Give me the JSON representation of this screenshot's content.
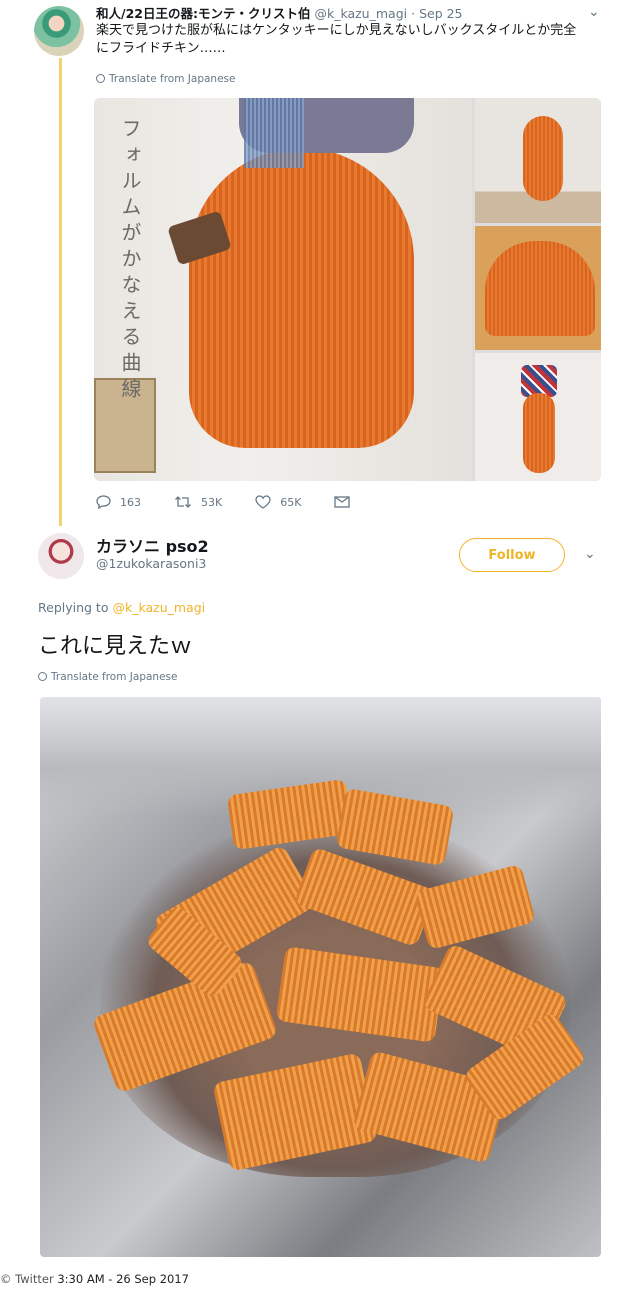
{
  "tweet1": {
    "display_name": "和人/22日王の器:モンテ・クリスト伯",
    "handle": "@k_kazu_magi",
    "separator": "·",
    "date": "Sep 25",
    "text": "楽天で見つけた服が私にはケンタッキーにしか見えないしバックスタイルとか完全にフライドチキン……",
    "translate": "Translate from Japanese",
    "image_caption": "フォルムがかなえる曲線",
    "stats": {
      "replies": "163",
      "retweets": "53K",
      "likes": "65K"
    }
  },
  "tweet2": {
    "display_name": "カラソニ pso2",
    "handle": "@1zukokarasoni3",
    "follow_label": "Follow",
    "replying_prefix": "Replying to",
    "replying_to": "@k_kazu_magi",
    "text": "これに見えたｗ",
    "translate": "Translate from Japanese"
  },
  "footer": {
    "watermark": "© Twitter",
    "timestamp": "3:30 AM - 26 Sep 2017"
  },
  "icons": {
    "reply": "speech-bubble-icon",
    "retweet": "retweet-icon",
    "like": "heart-icon",
    "message": "envelope-icon",
    "menu": "chevron-down-icon"
  },
  "colors": {
    "accent": "#f0b429",
    "muted": "#657786",
    "thread": "#f5d36b"
  }
}
